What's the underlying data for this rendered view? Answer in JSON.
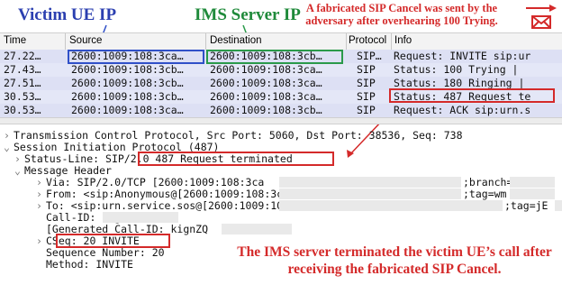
{
  "annotations": {
    "victim_ue_ip": "Victim UE IP",
    "ims_server_ip": "IMS Server IP",
    "cancel_note": "A fabricated SIP Cancel was sent by the adversary after overhearing 100 Trying.",
    "terminate_note": "The IMS server terminated the victim UE’s call after receiving the fabricated SIP Cancel."
  },
  "packet_list": {
    "columns": [
      "Time",
      "Source",
      "Destination",
      "Protocol",
      "Info"
    ],
    "rows": [
      {
        "time": "27.22…",
        "source": "2600:1009:108:3ca…",
        "destination": "2600:1009:108:3cb…",
        "protocol": "SIP…",
        "info": "Request: INVITE sip:ur"
      },
      {
        "time": "27.43…",
        "source": "2600:1009:108:3cb…",
        "destination": "2600:1009:108:3ca…",
        "protocol": "SIP",
        "info": "Status: 100 Trying |"
      },
      {
        "time": "27.51…",
        "source": "2600:1009:108:3cb…",
        "destination": "2600:1009:108:3ca…",
        "protocol": "SIP",
        "info": "Status: 180 Ringing |"
      },
      {
        "time": "30.53…",
        "source": "2600:1009:108:3cb…",
        "destination": "2600:1009:108:3ca…",
        "protocol": "SIP",
        "info": "Status: 487 Request te"
      },
      {
        "time": "30.53…",
        "source": "2600:1009:108:3ca…",
        "destination": "2600:1009:108:3cb…",
        "protocol": "SIP",
        "info": "Request: ACK sip:urn.s"
      }
    ]
  },
  "details": {
    "tcp": "Transmission Control Protocol, Src Port: 5060, Dst Port: 38536, Seq: 738",
    "sip": "Session Initiation Protocol (487)",
    "status_line_label": "Status-Line:",
    "status_line_value": "SIP/2.0 487 Request terminated",
    "message_header": "Message Header",
    "via": "Via: SIP/2.0/TCP [2600:1009:108:3ca",
    "via_tail": ";branch=z9",
    "from": "From: <sip:Anonymous@[2600:1009:108:3ca",
    "from_tail": ";tag=wm",
    "to": "To: <sip:urn.service.sos@[2600:1009:108:3cb",
    "to_tail": ";tag=jE",
    "call_id": "Call-ID: kignZQ",
    "gen_call_id": "[Generated Call-ID: kignZQ",
    "cseq": "CSeq: 20 INVITE",
    "seq_number": "Sequence Number: 20",
    "method": "Method: INVITE"
  },
  "colors": {
    "victim_blue": "#2b3fb0",
    "ims_green": "#1f8a3a",
    "alert_red": "#d42a2a",
    "row_highlight": "#dde0f4"
  },
  "icons": [
    "arrow-right-icon",
    "envelope-icon",
    "expand-chevron-icon",
    "collapse-chevron-icon"
  ]
}
